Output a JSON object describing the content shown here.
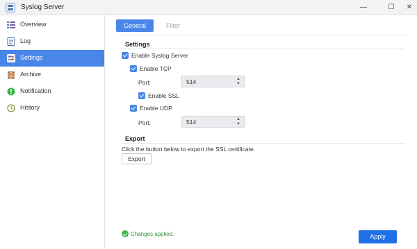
{
  "window": {
    "title": "Syslog Server",
    "minimize_glyph": "—",
    "maximize_glyph": "☐",
    "close_glyph": "✕"
  },
  "sidebar": {
    "items": [
      {
        "label": "Overview",
        "icon": "overview-icon"
      },
      {
        "label": "Log",
        "icon": "log-icon"
      },
      {
        "label": "Settings",
        "icon": "settings-icon",
        "active": true
      },
      {
        "label": "Archive",
        "icon": "archive-icon"
      },
      {
        "label": "Notification",
        "icon": "notification-icon"
      },
      {
        "label": "History",
        "icon": "history-icon"
      }
    ]
  },
  "tabs": [
    {
      "label": "General",
      "active": true
    },
    {
      "label": "Filter",
      "active": false
    }
  ],
  "settings": {
    "title": "Settings",
    "enable_syslog_server": {
      "label": "Enable Syslog Server",
      "checked": true
    },
    "enable_tcp": {
      "label": "Enable TCP",
      "checked": true
    },
    "tcp_port": {
      "label": "Port:",
      "value": "514"
    },
    "enable_ssl": {
      "label": "Enable SSL",
      "checked": true
    },
    "enable_udp": {
      "label": "Enable UDP",
      "checked": true
    },
    "udp_port": {
      "label": "Port:",
      "value": "514"
    }
  },
  "export": {
    "title": "Export",
    "description": "Click the button below to export the SSL certificate.",
    "button_label": "Export"
  },
  "footer": {
    "status_text": "Changes applied.",
    "apply_label": "Apply"
  },
  "colors": {
    "accent": "#4a86e8",
    "apply": "#1f6fe6",
    "success": "#3cb24a"
  }
}
